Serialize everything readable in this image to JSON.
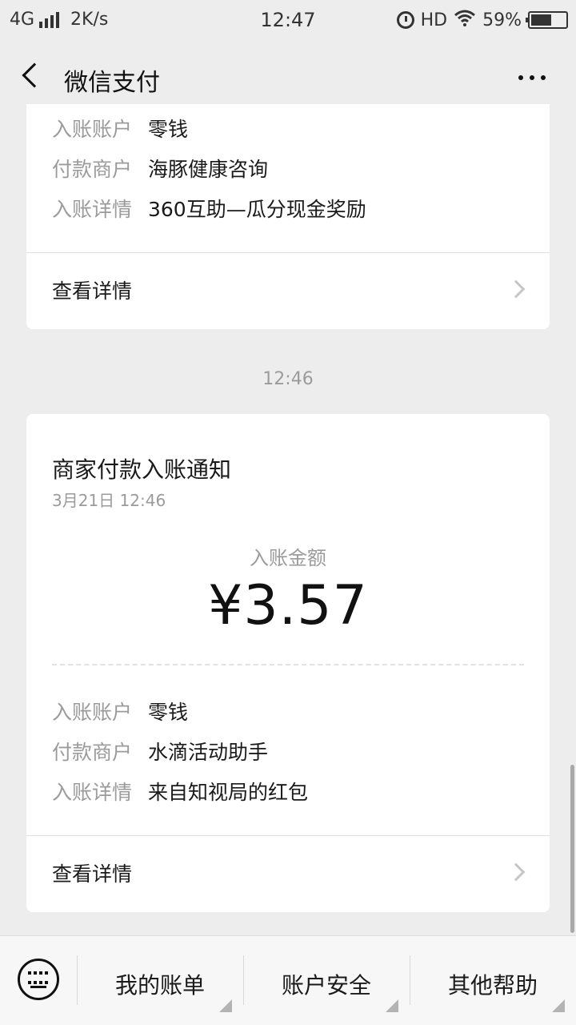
{
  "status_bar": {
    "network": "4G",
    "speed": "2K/s",
    "time": "12:47",
    "hd": "HD",
    "battery": "59%",
    "battery_level": 0.59
  },
  "header": {
    "title": "微信支付",
    "back_icon": "chevron-left-icon",
    "more_icon": "more-dots-icon"
  },
  "card_prev": {
    "rows": [
      {
        "label": "入账账户",
        "value": "零钱"
      },
      {
        "label": "付款商户",
        "value": "海豚健康咨询"
      },
      {
        "label": "入账详情",
        "value": "360互助—瓜分现金奖励"
      }
    ],
    "link": "查看详情"
  },
  "time_separator": "12:46",
  "card_main": {
    "title": "商家付款入账通知",
    "date": "3月21日  12:46",
    "amount_label": "入账金额",
    "amount": "¥3.57",
    "rows": [
      {
        "label": "入账账户",
        "value": "零钱"
      },
      {
        "label": "付款商户",
        "value": "水滴活动助手"
      },
      {
        "label": "入账详情",
        "value": "来自知视局的红包"
      }
    ],
    "link": "查看详情"
  },
  "bottom_menu": {
    "items": [
      {
        "label": "我的账单"
      },
      {
        "label": "账户安全"
      },
      {
        "label": "其他帮助"
      }
    ]
  }
}
